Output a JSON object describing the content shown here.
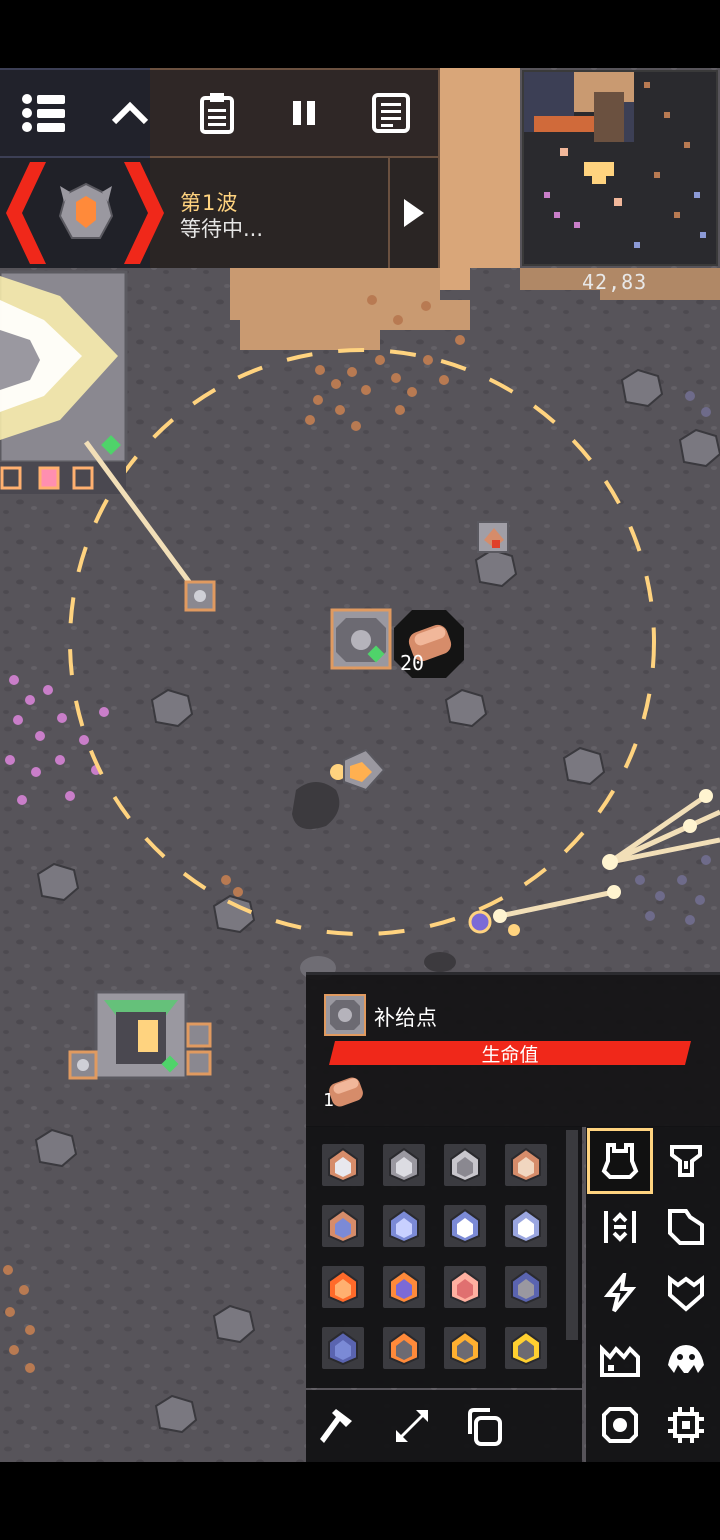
{
  "wave": {
    "title": "第1波",
    "status": "等待中..."
  },
  "coordinates": "42,83",
  "world_labels": {
    "core_item_count": "20"
  },
  "selected_block": {
    "name": "补给点",
    "health_label": "生命值",
    "health_fraction": 1.0,
    "item_count": "1"
  },
  "toolbar_icons": [
    "menu-icon",
    "chevron-up-icon",
    "clipboard-icon",
    "pause-icon",
    "database-icon"
  ],
  "build_categories": [
    "units-icon",
    "turret-icon",
    "distribution-icon",
    "crafting-icon",
    "power-icon",
    "defense-icon",
    "production-icon",
    "liquid-icon",
    "effect-icon",
    "logic-icon"
  ],
  "build_tools": [
    "hammer-icon",
    "expand-icon",
    "copy-icon"
  ],
  "unit_blocks": [
    "dagger",
    "mace",
    "fortress",
    "scepter",
    "nova",
    "pulsar",
    "quasar",
    "vela",
    "crawler",
    "atrax",
    "spiroct",
    "arkyid",
    "flare",
    "horizon",
    "zenith",
    "antumbra"
  ],
  "colors": {
    "accent": "#ffd37f",
    "health": "#f0281a",
    "range_circle": "#ffd37f"
  }
}
